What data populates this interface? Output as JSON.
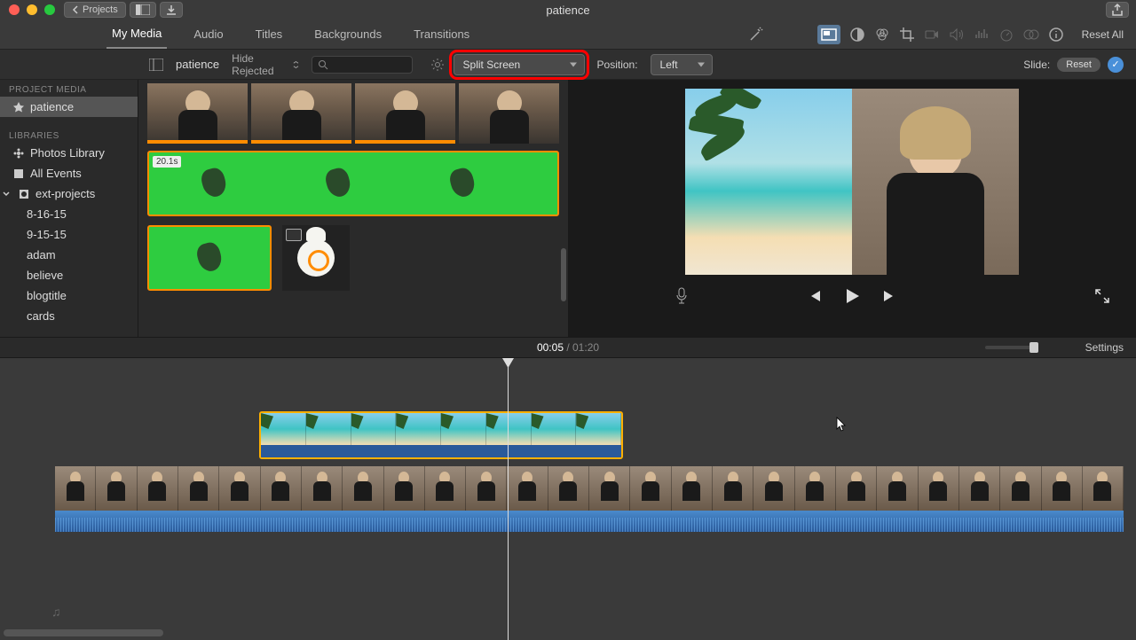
{
  "titlebar": {
    "project_name": "patience",
    "back_label": "Projects"
  },
  "tabs": {
    "my_media": "My Media",
    "audio": "Audio",
    "titles": "Titles",
    "backgrounds": "Backgrounds",
    "transitions": "Transitions"
  },
  "toolbar": {
    "reset_all": "Reset All"
  },
  "browser": {
    "title": "patience",
    "hide_rejected": "Hide Rejected"
  },
  "overlay": {
    "mode": "Split Screen",
    "position_label": "Position:",
    "position_value": "Left",
    "slide_label": "Slide:",
    "reset_label": "Reset"
  },
  "sidebar": {
    "project_media_header": "PROJECT MEDIA",
    "project_name": "patience",
    "libraries_header": "LIBRARIES",
    "photos_library": "Photos Library",
    "all_events": "All Events",
    "ext_projects": "ext-projects",
    "items": [
      "8-16-15",
      "9-15-15",
      "adam",
      "believe",
      "blogtitle",
      "cards"
    ]
  },
  "media": {
    "green_clip_duration": "20.1s"
  },
  "timecode": {
    "current": "00:05",
    "separator": " / ",
    "total": "01:20",
    "settings": "Settings"
  }
}
